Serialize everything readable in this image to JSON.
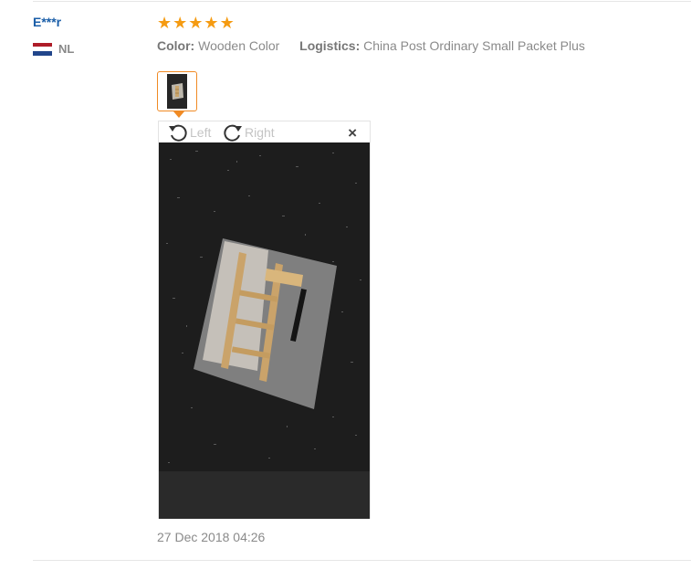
{
  "review": {
    "user": "E***r",
    "country": "NL",
    "rating": 5,
    "rating_max": 5,
    "color_label": "Color:",
    "color_value": "Wooden Color",
    "logistics_label": "Logistics:",
    "logistics_value": "China Post Ordinary Small Packet Plus",
    "date": "27 Dec 2018 04:26"
  },
  "viewer": {
    "rotate_left": "Left",
    "rotate_right": "Right",
    "close": "×"
  },
  "icons": {
    "star": "star-icon",
    "rotate_left": "rotate-left-icon",
    "rotate_right": "rotate-right-icon",
    "close": "close-icon",
    "flag": "netherlands-flag-icon"
  },
  "colors": {
    "user_link": "#1a5ea8",
    "star": "#f59b12",
    "thumb_border": "#f08a24",
    "flag_red": "#ae1c28",
    "flag_white": "#ffffff",
    "flag_blue": "#21468b"
  }
}
